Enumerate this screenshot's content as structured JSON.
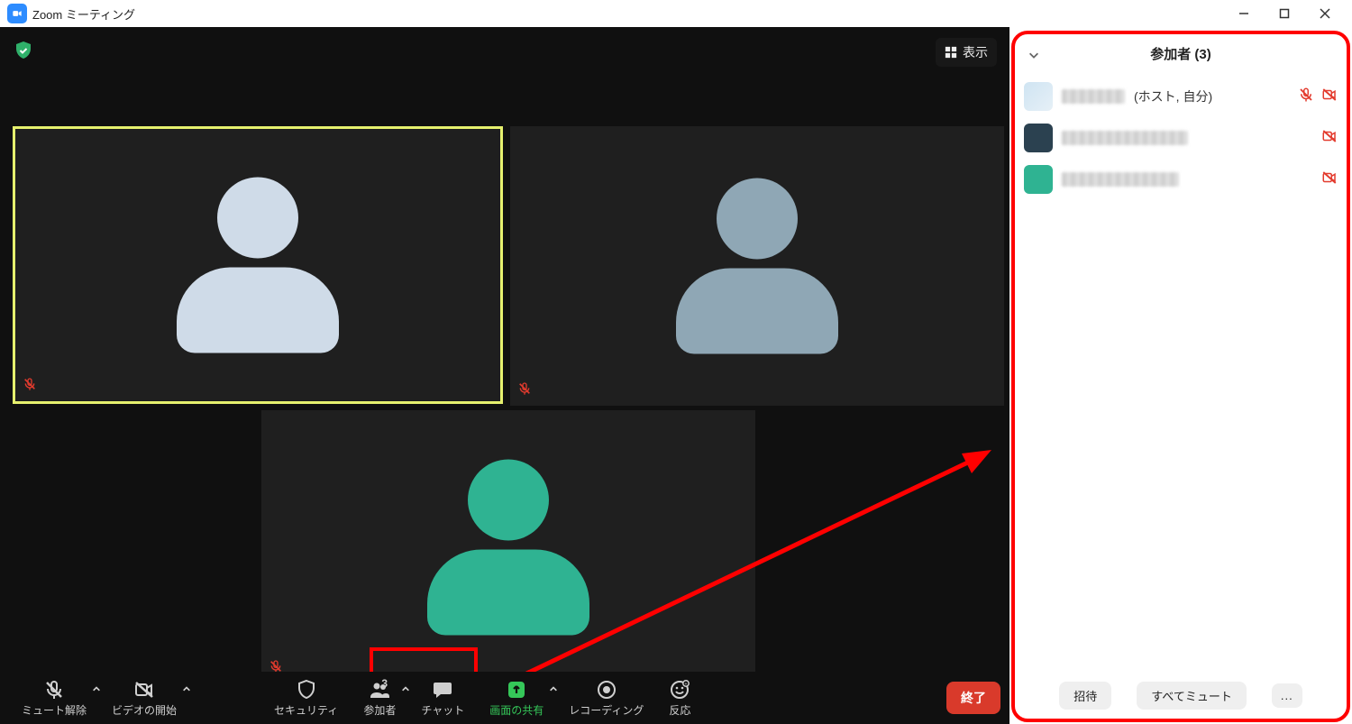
{
  "title": "Zoom ミーティング",
  "view_button": "表示",
  "toolbar": {
    "unmute": "ミュート解除",
    "start_video": "ビデオの開始",
    "security": "セキュリティ",
    "participants": "参加者",
    "participants_count": "3",
    "chat": "チャット",
    "share": "画面の共有",
    "record": "レコーディング",
    "reactions": "反応",
    "end": "終了"
  },
  "panel": {
    "title": "参加者 (3)",
    "rows": [
      {
        "tag": "(ホスト, 自分)",
        "muted": true,
        "video_off": true
      },
      {
        "tag": "",
        "muted": false,
        "video_off": true
      },
      {
        "tag": "",
        "muted": false,
        "video_off": true
      }
    ],
    "invite": "招待",
    "mute_all": "すべてミュート",
    "more": "..."
  }
}
